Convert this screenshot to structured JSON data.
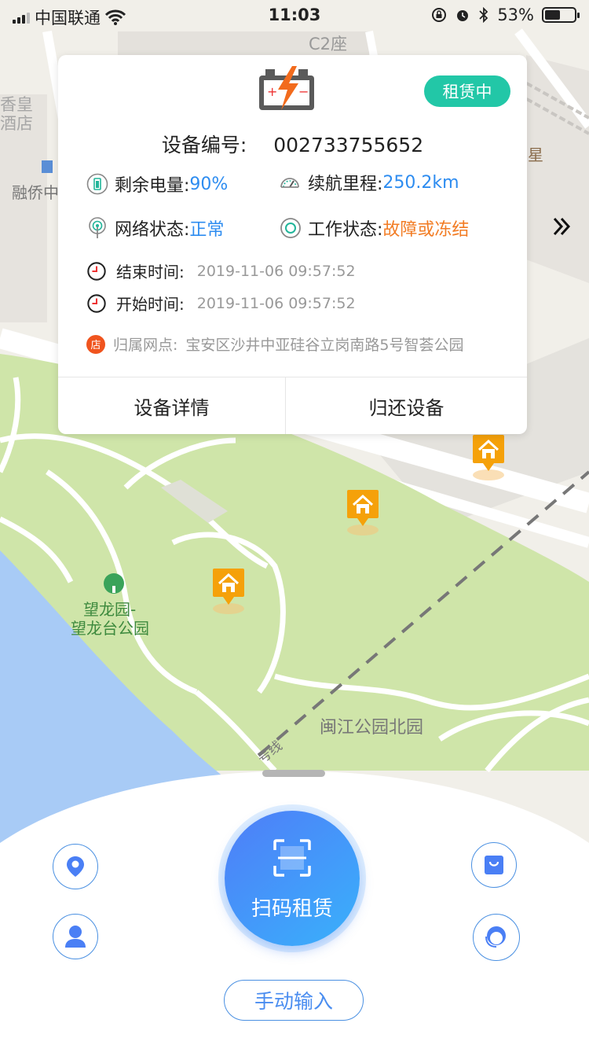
{
  "status_bar": {
    "carrier": "中国联通",
    "time": "11:03",
    "battery_percent": "53%",
    "battery_level": 0.53,
    "icons": [
      "signal-icon",
      "wifi-icon",
      "rotation-lock-icon",
      "alarm-icon",
      "bluetooth-icon",
      "battery-icon"
    ]
  },
  "map": {
    "labels": {
      "building_top": "C2座",
      "left_top_1": "香皇",
      "left_top_2": "酒店",
      "left_building": "融侨中",
      "right_building": "星",
      "park_name_1": "望龙园-",
      "park_name_2": "望龙台公园",
      "park_north": "闽江公园北园",
      "line_label": "号线"
    },
    "colors": {
      "park": "#cfe5a9",
      "water": "#a8cbf6",
      "road": "#ffffff",
      "ground": "#f1efe9"
    },
    "pin_icon": "store-house-pin-icon"
  },
  "device_card": {
    "status_badge": "租赁中",
    "device_id_label": "设备编号:",
    "device_id": "002733755652",
    "battery_label": "剩余电量:",
    "battery_value": "90%",
    "range_label": "续航里程:",
    "range_value": "250.2km",
    "network_label": "网络状态:",
    "network_value": "正常",
    "work_label": "工作状态:",
    "work_value": "故障或冻结",
    "end_time_label": "结束时间:",
    "end_time": "2019-11-06   09:57:52",
    "start_time_label": "开始时间:",
    "start_time": "2019-11-06   09:57:52",
    "store_badge": "店",
    "store_label": "归属网点:",
    "store_value": "宝安区沙井中亚硅谷立岗南路5号智荟公园",
    "detail_button": "设备详情",
    "return_button": "归还设备",
    "colors": {
      "badge": "#22c7a7",
      "value_blue": "#2d8cf0",
      "value_orange": "#f27c24"
    }
  },
  "bottom_panel": {
    "scan_button": "扫码租赁",
    "manual_button": "手动输入",
    "icons": [
      "location-icon",
      "user-icon",
      "shopping-bag-icon",
      "customer-service-icon",
      "scan-icon"
    ]
  }
}
